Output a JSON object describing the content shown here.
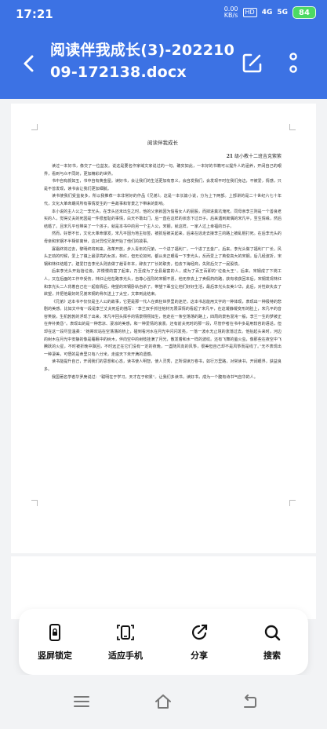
{
  "status_bar": {
    "time": "17:21",
    "net_speed_value": "0.00",
    "net_speed_unit": "KB/s",
    "hd_badge": "HD",
    "signal_1": "4G",
    "signal_2": "5G",
    "battery": "84"
  },
  "app_bar": {
    "title": "阅读伴我成长(3)-20221009-172138.docx"
  },
  "document": {
    "heading": "阅读伴我成长",
    "author_num": "21",
    "author_rest": " 级小教十二班吉克紫紫",
    "paragraphs": [
      "读过一本好书，像交了一位益友。说这是要名作家域文家说过的一句。确实如此，一本好的书籍可以提升人的涵养，开阔自己的眼界，看到与众不同的，更加精彩的世界。",
      "书中自有颜如玉，书中自有黄金屋。读好书，会让我们的生活更加有意义，会自发我们，会发现平时在我们身边，不被爱，情感，只是不曾发现，读书会让我们更加细腻。",
      "读书使我们受益良多，所以我推荐一本非常好的作品《兄弟》。这是一本长篇小说，分为上下两部。上部讲的是二十世纪六七十年代，文化大革命期间所有事情发生的一些故事和背景之下带来的影响。",
      "本小说的主人公之一李光头，在李头还未出生之时，他的父亲就因为偷看女人的屁股，而掉进粪坑淹死。同母亲李兰则是一个善良老实的人，觉得丈夫的死因是一件很羞耻的事情，白天不敢出门，后一直在这样的状态下过日子。后来遇到离偶的宋凡平，至生情缘，然后结婚了。且宋凡平也带来了一个孩子，就是本书中的另一个主人公，宋钢，就这样，一家人过上幸福的日子。",
      "然而，好景不长，文化大革命爆发，宋凡平因为地主标签，被抓后被关起来，后来在逃走去接李兰的路上被乱棍打死。在后李光头的母亲和宋钢不半相依离世，这对异性兄弟开始了他们的故事。",
      "寡霜终将过去，黎明终将到来。改革开放，步入青年的兄弟，一个进了福利厂，一个进了五金厂。后来，李光头做了福利厂厂长，风头正劲的时候，爱上了镇上最漂亮的女孩，林红，但无论如何，都从未正眼看一下李光头，反而爱上了英俊高大的宋钢。后几经波折，宋钢和林红结婚了。建爱打击李光头则去做了趟青年本，辞去了厂长的职务，怕去下海经商，失败后欠了一屁股债。",
      "后来李光头开始拾垃圾，并慢慢的富了起来，乃至成为了全县最富的人，成为了百王百即的“垃圾大王”。后来，宋钢成了下岗工人，又在后面的工作中受伤，林红让他在路李光头，自尊心强烈的宋钢不愿，他无奈去上了卖假药的路，获有收获回本后，宋钢发现林红和李光头二人背着自己在一起偷情后，绝望的宋钢卧轨自杀了。带望下辈宝让他们好好生活，最后李光头去美少华，此后，对性欲失去了欲望，并把他最好的兄弟宋钢的骨灰送上了太空，文章到此结束。",
      "《兄弟》这本书不仅仅是主人公的故事，它更是那一代人在疯狂世界里的迷茫。这本书总能用文字的一种体现，表现出一种极特的悲剧的美感。比如文中有一段是李兰丈夫死后的描写：“李兰双手抓住棺材无限深情的看起了宋凡平，在这凝静凝变形的脸上，宋凡平的音容笑貌，生机勃勃的浮现了出来，宋凡平回头挥手的情景栩栩如生，他走在一条空荡荡的路上，四周的景色混沌一般，李兰一生的梦被正在弃补黄昏”。表现出的是一种悲凉、凄凉的美感，和一种爱情的浪漫。还有前夫死时的那一段，尽管作者在书中多是用较容的语话，但却在这一段尽显温柔：“她寄欢站在空荡荡的桥上，碰到看河水在月光中闪闪发亮，一落一波水无止境的涨落过去。他抬起头来时，河边的树木在月光中安静的像是睡眠中的树木，伴向空中的树枝挂满了月光，散发着和水一样的波纹。还有飞舞的萤火虫，像那些在夜空中飞腾跃的火星，不时被折晚中飘回，不时远正在它们没有一定的夜晚，一盏随风向的风筝，很美但自己却不是风筝而是线了。”无不表现出一种凄美，可悟的是命里只有八分米，走遍天下未开满的遗憾。",
      "读书能提升自己，开阔我们的思想和心态，读书使人明智，使人灵秀，正所谓读万卷书，如行万里路，对常读书，开阔眼界，获益良多。",
      "我国著名学者华罗庚说过：“聪明在于学习，天才在于积累”。让我们多读书，读好书，成为一个腹有诗书气自华的人。"
    ]
  },
  "tools": [
    {
      "label": "竖屏锁定",
      "icon": "portrait-lock-icon"
    },
    {
      "label": "适应手机",
      "icon": "fit-phone-icon"
    },
    {
      "label": "分享",
      "icon": "share-icon"
    },
    {
      "label": "搜索",
      "icon": "search-icon"
    }
  ],
  "colors": {
    "brand": "#3c72e4",
    "battery": "#4cd964"
  }
}
